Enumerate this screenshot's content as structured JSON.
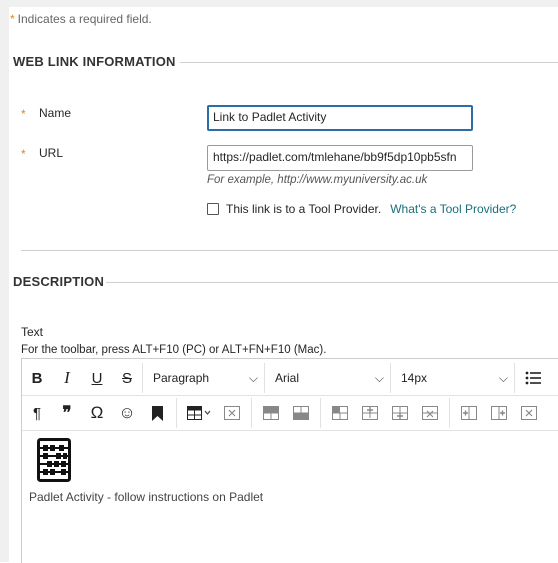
{
  "required_note": {
    "star": "*",
    "text": "Indicates a required field."
  },
  "web_link_section": {
    "title": "WEB LINK INFORMATION",
    "name_label": "Name",
    "name_value": "Link to Padlet Activity",
    "url_label": "URL",
    "url_value": "https://padlet.com/tmlehane/bb9f5dp10pb5sfn",
    "url_hint": "For example, http://www.myuniversity.ac.uk",
    "tool_provider_checkbox_label": "This link is to a Tool Provider.",
    "tool_provider_checked": false,
    "tool_provider_help_link": "What's a Tool Provider?"
  },
  "description_section": {
    "title": "DESCRIPTION",
    "editor_label": "Text",
    "editor_help": "For the toolbar, press ALT+F10 (PC) or ALT+FN+F10 (Mac).",
    "toolbar": {
      "row1": {
        "bold": "B",
        "italic": "I",
        "underline": "U",
        "strikethrough": "S",
        "block_format": "Paragraph",
        "font_family": "Arial",
        "font_size": "14px"
      },
      "row2": {
        "paragraph_mark": "¶",
        "blockquote": "❞",
        "special_char": "Ω",
        "emoji": "☺"
      }
    },
    "content_text": "Padlet Activity - follow instructions on Padlet"
  }
}
